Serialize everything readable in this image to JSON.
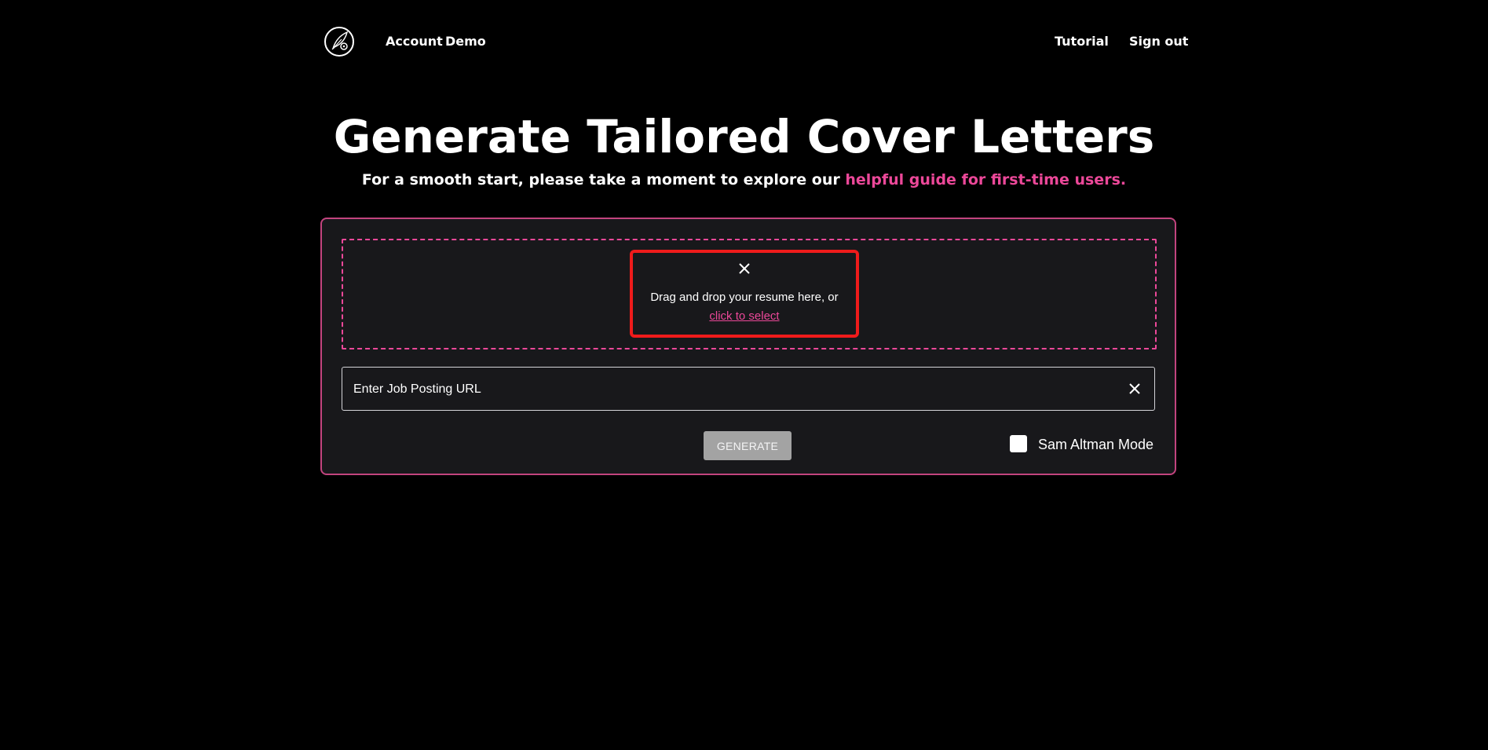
{
  "nav": {
    "logo_icon": "feather-gear-logo",
    "account_label": "Account",
    "demo_label": "Demo",
    "tutorial_label": "Tutorial",
    "signout_label": "Sign out"
  },
  "hero": {
    "title": "Generate Tailored Cover Letters",
    "subtitle_prefix": "For a smooth start, please take a moment to explore our ",
    "subtitle_link": "helpful guide for first-time users."
  },
  "upload": {
    "close_icon": "close-icon",
    "prompt": "Drag and drop your resume here, or",
    "select_link": "click to select"
  },
  "job_url": {
    "placeholder": "Enter Job Posting URL",
    "value": "",
    "clear_icon": "close-icon"
  },
  "actions": {
    "generate_label": "GENERATE",
    "mode_label": "Sam Altman Mode",
    "mode_checked": false
  },
  "colors": {
    "background": "#000000",
    "panel": "#18181b",
    "accent": "#ec4899",
    "highlight_border": "#ef1b1b",
    "button_disabled": "#a3a3a3"
  }
}
